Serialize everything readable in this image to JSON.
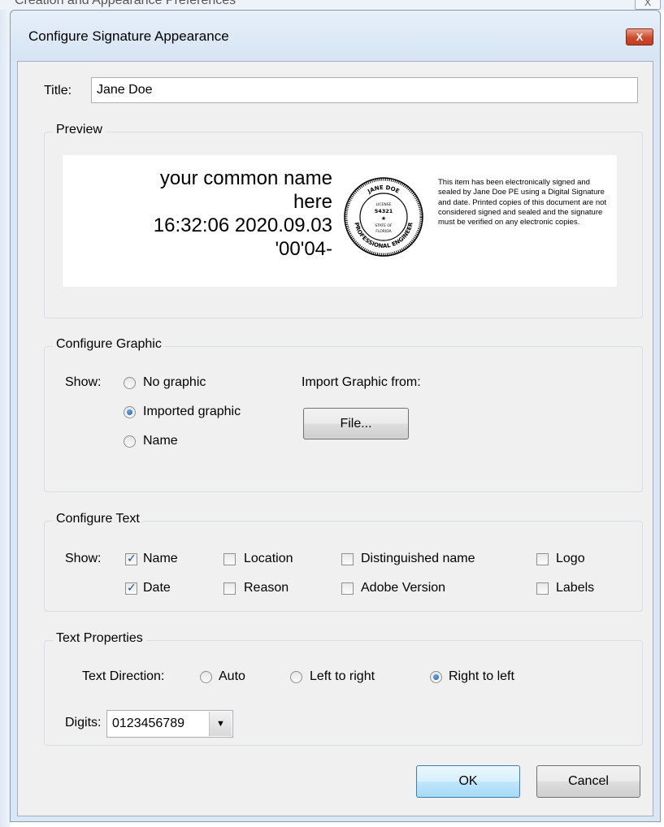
{
  "parent_window": {
    "title": "Creation and Appearance Preferences",
    "close_label": "X"
  },
  "dialog": {
    "title": "Configure Signature Appearance",
    "close_label": "X"
  },
  "title_field": {
    "label": "Title:",
    "value": "Jane Doe"
  },
  "preview": {
    "legend": "Preview",
    "name_lines": [
      "your common name",
      "here",
      "16:32:06 2020.09.03",
      "'00'04-"
    ],
    "seal_text": {
      "top": "JANE DOE",
      "license": "LICENSE",
      "number": "54321",
      "state": "STATE OF",
      "state_name": "FLORIDA",
      "outer": "PROFESSIONAL ENGINEER"
    },
    "note": "This item has been electronically signed and sealed by Jane Doe PE using a Digital Signature and date. Printed copies of this document are not considered signed and sealed and the signature must be verified on any electronic copies."
  },
  "configure_graphic": {
    "legend": "Configure Graphic",
    "show_label": "Show:",
    "options": [
      {
        "label": "No graphic",
        "checked": false
      },
      {
        "label": "Imported graphic",
        "checked": true
      },
      {
        "label": "Name",
        "checked": false
      }
    ],
    "import_label": "Import Graphic from:",
    "file_button": "File..."
  },
  "configure_text": {
    "legend": "Configure Text",
    "show_label": "Show:",
    "checkboxes": [
      {
        "label": "Name",
        "checked": true
      },
      {
        "label": "Location",
        "checked": false
      },
      {
        "label": "Distinguished name",
        "checked": false
      },
      {
        "label": "Logo",
        "checked": false
      },
      {
        "label": "Date",
        "checked": true
      },
      {
        "label": "Reason",
        "checked": false
      },
      {
        "label": "Adobe Version",
        "checked": false
      },
      {
        "label": "Labels",
        "checked": false
      }
    ]
  },
  "text_properties": {
    "legend": "Text Properties",
    "direction_label": "Text Direction:",
    "directions": [
      {
        "label": "Auto",
        "checked": false
      },
      {
        "label": "Left to right",
        "checked": false
      },
      {
        "label": "Right to left",
        "checked": true
      }
    ],
    "digits_label": "Digits:",
    "digits_value": "0123456789"
  },
  "buttons": {
    "ok": "OK",
    "cancel": "Cancel"
  }
}
